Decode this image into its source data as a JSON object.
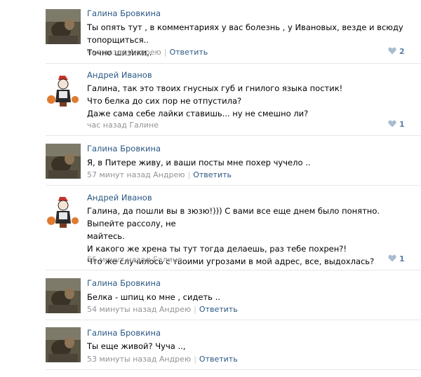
{
  "colors": {
    "link": "#2a5885",
    "meta": "#939393",
    "divider": "#e7e8ec",
    "heart": "#a9bcd1"
  },
  "comments": [
    {
      "author": "Галина Бровкина",
      "avatar": "galina-photo",
      "text": "Ты опять тут , в комментариях у вас болезнь , у Ивановых, везде и всюду топорщиться..\nТочно шизики,.",
      "time": "час назад Андрею",
      "reply": "Ответить",
      "likes": "2"
    },
    {
      "author": "Андрей Иванов",
      "avatar": "andrey-cartoon",
      "text": "Галина, так это твоих гнусных губ и гнилого языка постик!\nЧто белка до сих пор не отпустила?\nДаже сама себе лайки ставишь... ну не смешно ли?",
      "time": "час назад Галине",
      "reply": "",
      "likes": "1"
    },
    {
      "author": "Галина Бровкина",
      "avatar": "galina-photo",
      "text": "Я, в Питере живу, и ваши посты мне похер чучело ..",
      "time": "57 минут назад Андрею",
      "reply": "Ответить",
      "likes": ""
    },
    {
      "author": "Андрей Иванов",
      "avatar": "andrey-cartoon",
      "text": "Галина, да пошли вы в зюзю!))) С вами все еще днем было понятно. Выпейте рассолу, не\nмайтесь.\nИ какого же хрена ты тут тогда делаешь, раз тебе похрен?!\nЧто же случилось с твоими угрозами в мой адрес, все, выдохлась?",
      "time": "55 минут назад Галине",
      "reply": "",
      "likes": "1"
    },
    {
      "author": "Галина Бровкина",
      "avatar": "galina-photo",
      "text": "Белка - шпиц ко мне , сидеть ..",
      "time": "54 минуты назад Андрею",
      "reply": "Ответить",
      "likes": ""
    },
    {
      "author": "Галина Бровкина",
      "avatar": "galina-photo",
      "text": "Ты еще живой? Чуча ..,",
      "time": "53 минуты назад Андрею",
      "reply": "Ответить",
      "likes": ""
    }
  ]
}
